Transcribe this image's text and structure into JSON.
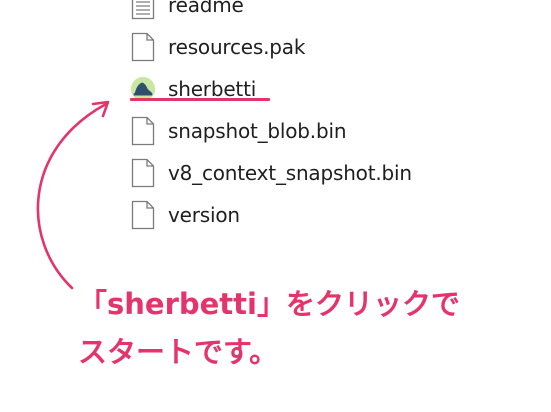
{
  "files": [
    {
      "name": "readme",
      "icon": "text-file-icon"
    },
    {
      "name": "resources.pak",
      "icon": "file-icon"
    },
    {
      "name": "sherbetti",
      "icon": "sherbetti-app-icon"
    },
    {
      "name": "snapshot_blob.bin",
      "icon": "file-icon"
    },
    {
      "name": "v8_context_snapshot.bin",
      "icon": "file-icon"
    },
    {
      "name": "version",
      "icon": "file-icon"
    }
  ],
  "caption": {
    "line1": "「sherbetti」をクリックで",
    "line2": "スタートです。"
  },
  "colors": {
    "accent": "#e5336b",
    "text": "#1f1f1f",
    "icon_outline": "#7a7a7a",
    "app_icon_bg": "#c9e6a3",
    "app_icon_shape": "#2f4f6f"
  }
}
